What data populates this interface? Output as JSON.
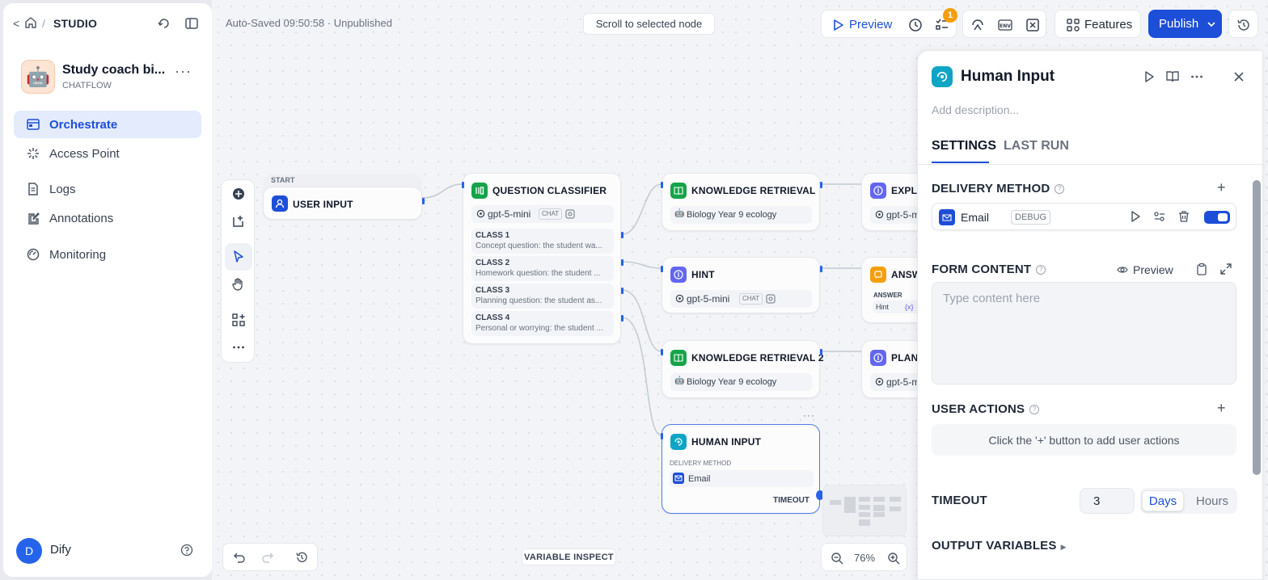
{
  "breadcrumb": {
    "back": "<",
    "separator": "/",
    "section": "STUDIO"
  },
  "app": {
    "name": "Study coach bi...",
    "type": "CHATFLOW",
    "avatar": "🤖",
    "more": "···"
  },
  "nav": [
    {
      "label": "Orchestrate"
    },
    {
      "label": "Access Point"
    },
    {
      "label": "Logs"
    },
    {
      "label": "Annotations"
    },
    {
      "label": "Monitoring"
    }
  ],
  "user": {
    "initial": "D",
    "name": "Dify"
  },
  "header": {
    "autosave": "Auto-Saved 09:50:58 · Unpublished",
    "scroll_to_node": "Scroll to selected node",
    "preview": "Preview",
    "checklist_badge": "1",
    "features": "Features",
    "publish": "Publish",
    "env_label": "ENV"
  },
  "nodes": {
    "start": {
      "tag": "START",
      "title": "USER INPUT"
    },
    "classifier": {
      "title": "QUESTION CLASSIFIER",
      "model": "gpt-5-mini",
      "model_mode": "CHAT",
      "classes": [
        {
          "name": "CLASS 1",
          "desc": "Concept question: the student wa..."
        },
        {
          "name": "CLASS 2",
          "desc": "Homework question: the student ..."
        },
        {
          "name": "CLASS 3",
          "desc": "Planning question: the student as..."
        },
        {
          "name": "CLASS 4",
          "desc": "Personal or worrying: the student ..."
        }
      ]
    },
    "kr1": {
      "title": "KNOWLEDGE RETRIEVAL",
      "dataset": "Biology Year 9 ecology"
    },
    "hint": {
      "title": "HINT",
      "model": "gpt-5-mini",
      "model_mode": "CHAT"
    },
    "kr2": {
      "title": "KNOWLEDGE RETRIEVAL 2",
      "dataset": "Biology Year 9 ecology"
    },
    "human": {
      "title": "HUMAN INPUT",
      "section": "DELIVERY METHOD",
      "method": "Email",
      "timeout": "TIMEOUT",
      "more": "···"
    },
    "expl": {
      "title": "EXPLA",
      "model": "gpt-5-m"
    },
    "answer": {
      "title": "ANSW",
      "section": "ANSWER",
      "var": "Hint",
      "var_prefix": "{x}"
    },
    "plan": {
      "title": "PLANN",
      "model": "gpt-5-m"
    }
  },
  "canvas_footer": {
    "variable_inspect": "VARIABLE INSPECT",
    "zoom": "76%"
  },
  "panel": {
    "title": "Human Input",
    "description_placeholder": "Add description...",
    "tabs": [
      {
        "label": "SETTINGS"
      },
      {
        "label": "LAST RUN"
      }
    ],
    "delivery": {
      "heading": "DELIVERY METHOD",
      "method": "Email",
      "badge": "DEBUG",
      "enabled": true
    },
    "form": {
      "heading": "FORM CONTENT",
      "preview": "Preview",
      "placeholder": "Type content here"
    },
    "user_actions": {
      "heading": "USER ACTIONS",
      "hint": "Click the '+' button to add user actions"
    },
    "timeout": {
      "heading": "TIMEOUT",
      "value": "3",
      "units": [
        "Days",
        "Hours"
      ],
      "selected": "Days"
    },
    "output": {
      "heading": "OUTPUT VARIABLES"
    }
  },
  "colors": {
    "accent": "#1d4ed8",
    "classifier": "#16a34a",
    "llm": "#6366f1",
    "answer": "#f59e0b",
    "human": "#0ea5c5"
  }
}
